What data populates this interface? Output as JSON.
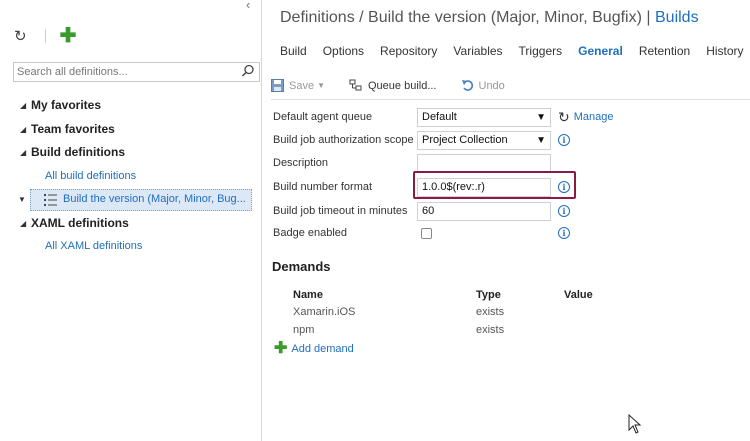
{
  "sidebar": {
    "search_placeholder": "Search all definitions...",
    "groups": [
      {
        "label": "My favorites"
      },
      {
        "label": "Team favorites"
      },
      {
        "label": "Build definitions"
      },
      {
        "label": "All build definitions"
      },
      {
        "label": "Build the version (Major, Minor, Bug..."
      },
      {
        "label": "XAML definitions"
      },
      {
        "label": "All XAML definitions"
      }
    ]
  },
  "header": {
    "title_prefix": "Definitions / Build the version (Major, Minor, Bugfix)",
    "pipe": "|",
    "builds_link": "Builds"
  },
  "tabs": [
    "Build",
    "Options",
    "Repository",
    "Variables",
    "Triggers",
    "General",
    "Retention",
    "History"
  ],
  "commands": {
    "save": "Save",
    "queue_build": "Queue build...",
    "undo": "Undo"
  },
  "form": {
    "agent_queue_label": "Default agent queue",
    "agent_queue_value": "Default",
    "manage_link": "Manage",
    "auth_scope_label": "Build job authorization scope",
    "auth_scope_value": "Project Collection",
    "description_label": "Description",
    "description_value": "",
    "build_number_label": "Build number format",
    "build_number_value": "1.0.0$(rev:.r)",
    "timeout_label": "Build job timeout in minutes",
    "timeout_value": "60",
    "badge_label": "Badge enabled"
  },
  "demands": {
    "title": "Demands",
    "headers": {
      "name": "Name",
      "type": "Type",
      "value": "Value"
    },
    "rows": [
      {
        "name": "Xamarin.iOS",
        "type": "exists"
      },
      {
        "name": "npm",
        "type": "exists"
      }
    ],
    "add_label": "Add demand"
  },
  "colors": {
    "link": "#1e6fbf",
    "highlight_border": "#8b1a44",
    "add_green": "#3a9a2e"
  }
}
